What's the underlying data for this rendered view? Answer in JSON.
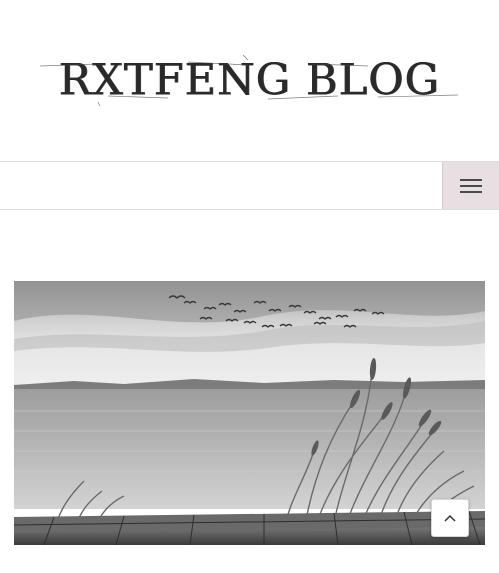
{
  "site": {
    "logo_text": "RXTFENG BLOG"
  },
  "nav": {
    "menu_icon": "hamburger-menu-icon"
  },
  "hero": {
    "image": "black-and-white-lake-with-birds-reeds-and-wooden-pier"
  },
  "scroll_top": {
    "icon": "chevron-up-icon"
  },
  "colors": {
    "menu_button_bg": "#e8dfe3",
    "border": "#dcdcdc"
  }
}
